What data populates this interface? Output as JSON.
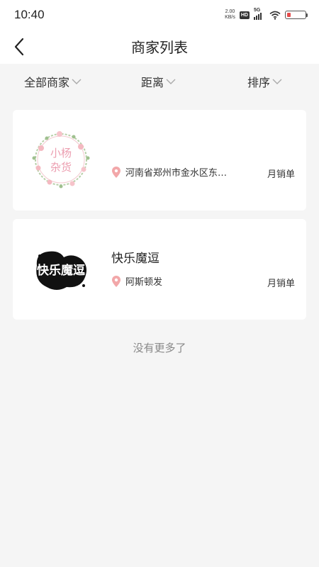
{
  "status_bar": {
    "time": "10:40",
    "net_speed_value": "2.00",
    "net_speed_unit": "KB/s",
    "hd_label": "HD",
    "network_label": "5G",
    "battery_color": "#e54c4c"
  },
  "header": {
    "title": "商家列表"
  },
  "filters": [
    {
      "label": "全部商家"
    },
    {
      "label": "距离"
    },
    {
      "label": "排序"
    }
  ],
  "merchants": [
    {
      "name": "",
      "logo_text_1": "小杨",
      "logo_text_2": "杂货",
      "address": "河南省郑州市金水区东风路",
      "sales_label": "月销单"
    },
    {
      "name": "快乐魔逗",
      "logo_text": "快乐魔逗",
      "address": "阿斯顿发",
      "sales_label": "月销单"
    }
  ],
  "footer": {
    "no_more": "没有更多了"
  },
  "colors": {
    "accent_pin": "#f2a7a9",
    "page_bg": "#f5f5f5"
  }
}
